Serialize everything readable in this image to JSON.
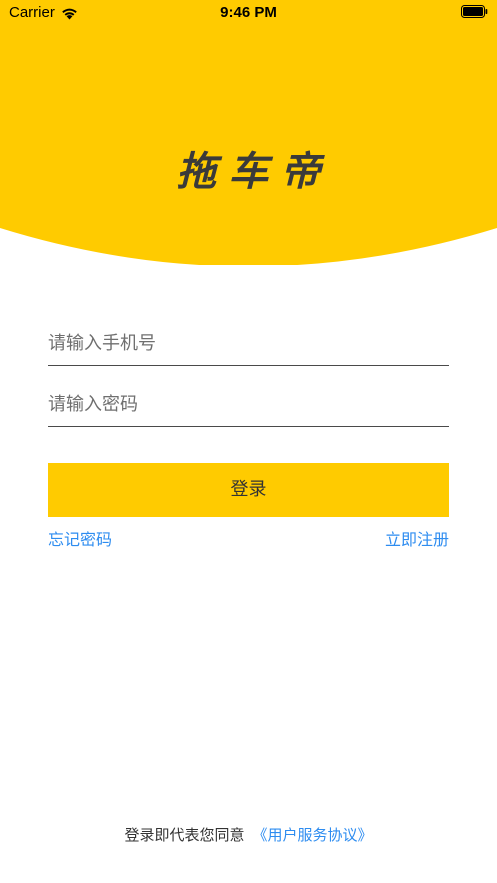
{
  "colors": {
    "accent": "#ffcb00",
    "link": "#2d8cf0",
    "text": "#333333",
    "background": "#ffffff"
  },
  "status_bar": {
    "carrier": "Carrier",
    "time": "9:46 PM",
    "wifi_icon": "wifi-icon",
    "battery_icon": "battery-icon"
  },
  "header": {
    "logo_text": "拖车帝"
  },
  "form": {
    "phone_placeholder": "请输入手机号",
    "password_placeholder": "请输入密码",
    "login_label": "登录",
    "forgot_password": "忘记密码",
    "register": "立即注册"
  },
  "footer": {
    "agreement_prefix": "登录即代表您同意",
    "agreement_link": "《用户服务协议》"
  }
}
